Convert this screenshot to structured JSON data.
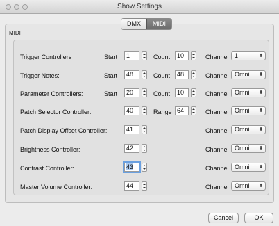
{
  "window": {
    "title": "Show Settings"
  },
  "tabs": [
    {
      "label": "DMX"
    },
    {
      "label": "MIDI"
    }
  ],
  "section": {
    "label": "MIDI"
  },
  "rows": [
    {
      "label": "Trigger Controllers",
      "start_label": "Start",
      "start": "1",
      "count_label": "Count",
      "count": "10",
      "channel_label": "Channel",
      "channel": "1"
    },
    {
      "label": "Trigger Notes:",
      "start_label": "Start",
      "start": "48",
      "count_label": "Count",
      "count": "48",
      "channel_label": "Channel",
      "channel": "Omni"
    },
    {
      "label": "Parameter Controllers:",
      "start_label": "Start",
      "start": "20",
      "count_label": "Count",
      "count": "10",
      "channel_label": "Channel",
      "channel": "Omni"
    },
    {
      "label": "Patch Selector Controller:",
      "value": "40",
      "range_label": "Range",
      "range": "64",
      "channel_label": "Channel",
      "channel": "Omni"
    },
    {
      "label": "Patch Display Offset Controller:",
      "value": "41",
      "channel_label": "Channel",
      "channel": "Omni"
    },
    {
      "label": "Brightness Controller:",
      "value": "42",
      "channel_label": "Channel",
      "channel": "Omni"
    },
    {
      "label": "Contrast Controller:",
      "value": "43",
      "channel_label": "Channel",
      "channel": "Omni"
    },
    {
      "label": "Master Volume Controller:",
      "value": "44",
      "channel_label": "Channel",
      "channel": "Omni"
    }
  ],
  "buttons": {
    "cancel": "Cancel",
    "ok": "OK"
  }
}
